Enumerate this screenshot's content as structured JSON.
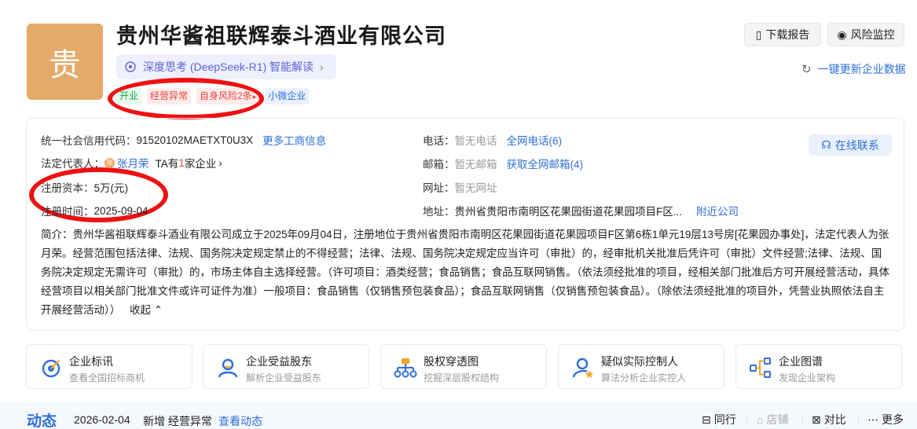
{
  "company": {
    "logo_char": "贵",
    "name": "贵州华酱祖联辉泰斗酒业有限公司",
    "ai_label": "深度思考 (DeepSeek-R1) 智能解读",
    "tags": [
      "开业",
      "经营异常",
      "自身风险2条",
      "小微企业"
    ]
  },
  "header_actions": {
    "download": "下载报告",
    "monitor": "风险监控",
    "refresh": "一键更新企业数据"
  },
  "info": {
    "credit_code_label": "统一社会信用代码：",
    "credit_code": "91520102MAETXT0U3X",
    "more_business": "更多工商信息",
    "legal_rep_label": "法定代表人：",
    "legal_rep_avatar": "张",
    "legal_rep": "张月荣",
    "legal_rep_suffix_a": "TA有",
    "legal_rep_count": "1",
    "legal_rep_suffix_b": "家企业",
    "capital_label": "注册资本：",
    "capital": "5万(元)",
    "reg_date_label": "注册时间：",
    "reg_date": "2025-09-04",
    "phone_label": "电话：",
    "phone": "暂无电话",
    "phone_link": "全网电话(6)",
    "email_label": "邮箱：",
    "email": "暂无邮箱",
    "email_link": "获取全网邮箱(4)",
    "website_label": "网址：",
    "website": "暂无网址",
    "address_label": "地址：",
    "address": "贵州省贵阳市南明区花果园街道花果园项目F区...",
    "nearby": "附近公司",
    "online_contact": "在线联系",
    "intro": "简介：贵州华酱祖联辉泰斗酒业有限公司成立于2025年09月04日，注册地位于贵州省贵阳市南明区花果园街道花果园项目F区第6栋1单元19层13号房[花果园办事处]，法定代表人为张月荣。经营范围包括法律、法规、国务院决定规定禁止的不得经营；法律、法规、国务院决定规定应当许可（审批）的，经审批机关批准后凭许可（审批）文件经营;法律、法规、国务院决定规定无需许可（审批）的，市场主体自主选择经营。（许可项目：酒类经营；食品销售；食品互联网销售。（依法须经批准的项目，经相关部门批准后方可开展经营活动，具体经营项目以相关部门批准文件或许可证件为准）一般项目：食品销售（仅销售预包装食品）；食品互联网销售（仅销售预包装食品）。（除依法须经批准的项目外，凭营业执照依法自主开展经营活动））",
    "collapse": "收起"
  },
  "cards": [
    {
      "title": "企业标讯",
      "sub": "查看全国招标商机",
      "icon": "target-icon"
    },
    {
      "title": "企业受益股东",
      "sub": "解析企业受益股东",
      "icon": "user-icon"
    },
    {
      "title": "股权穿透图",
      "sub": "挖掘深层股权结构",
      "icon": "org-chart-icon"
    },
    {
      "title": "疑似实际控制人",
      "sub": "算法分析企业实控人",
      "icon": "user-star-icon"
    },
    {
      "title": "企业图谱",
      "sub": "发现企业架构",
      "icon": "graph-icon"
    }
  ],
  "dynamics": {
    "title": "动态",
    "date": "2026-02-04",
    "event": "新增 经营异常",
    "view": "查看动态",
    "peers": "同行",
    "shops": "店铺",
    "compare": "对比",
    "more": "更多"
  },
  "colors": {
    "brand": "#2e6fd9",
    "logo_bg": "#e5a96a",
    "risk_red": "#e8423a",
    "annotation_red": "#ee1111"
  }
}
